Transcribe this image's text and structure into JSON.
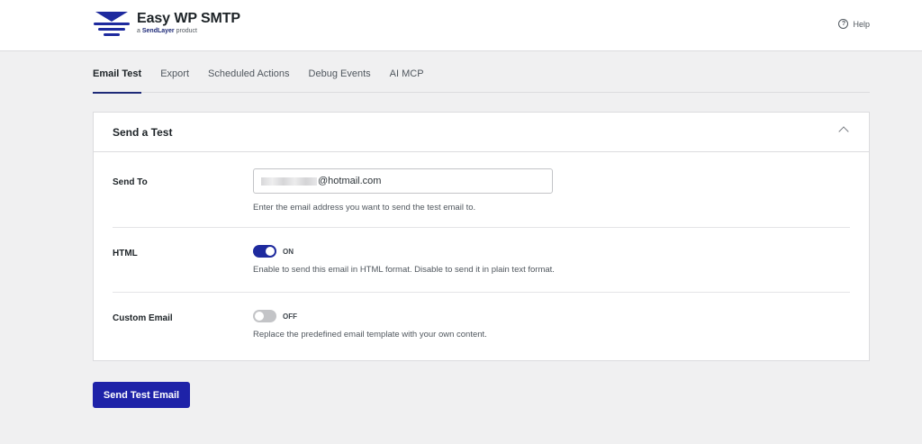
{
  "header": {
    "brand": "Easy WP SMTP",
    "sub_prefix": "a",
    "sub_brand": "SendLayer",
    "sub_suffix": "product",
    "help_label": "Help",
    "help_icon": "?"
  },
  "tabs": [
    {
      "label": "Email Test",
      "active": true
    },
    {
      "label": "Export"
    },
    {
      "label": "Scheduled Actions"
    },
    {
      "label": "Debug Events"
    },
    {
      "label": "AI MCP"
    }
  ],
  "card": {
    "title": "Send a Test",
    "rows": {
      "send_to": {
        "label": "Send To",
        "value": "@hotmail.com",
        "description": "Enter the email address you want to send the test email to."
      },
      "html": {
        "label": "HTML",
        "toggle_state": "ON",
        "description": "Enable to send this email in HTML format. Disable to send it in plain text format."
      },
      "custom_email": {
        "label": "Custom Email",
        "toggle_state": "OFF",
        "description": "Replace the predefined email template with your own content."
      }
    }
  },
  "send_button": "Send Test Email",
  "colors": {
    "accent": "#1e2a9e",
    "button": "#1e22a8",
    "background": "#f0f0f1"
  }
}
